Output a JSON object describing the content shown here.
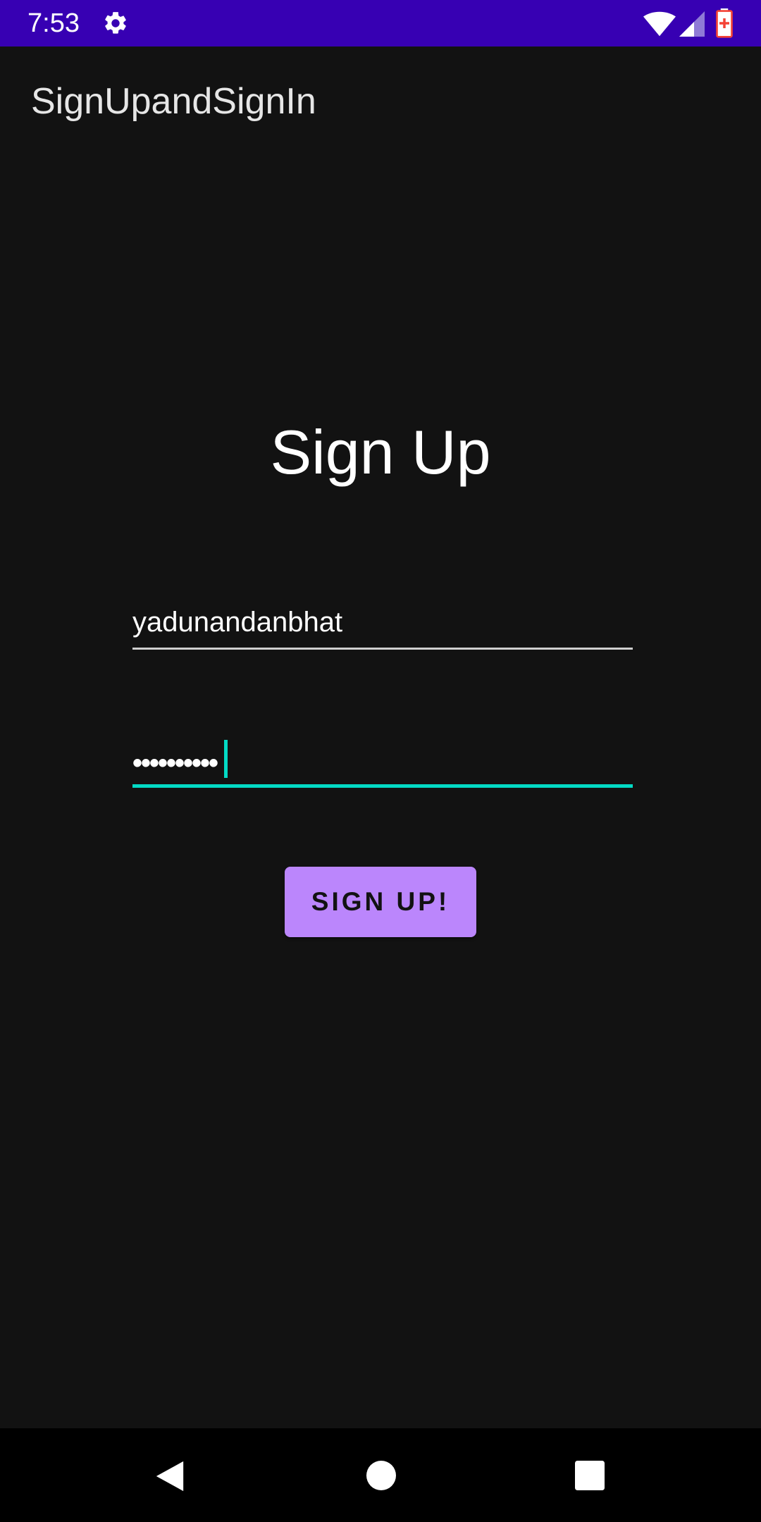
{
  "status_bar": {
    "time": "7:53",
    "background_color": "#3700b3",
    "icons": [
      "gear-icon",
      "wifi-icon",
      "cell-signal-icon",
      "battery-icon"
    ]
  },
  "app_bar": {
    "title": "SignUpandSignIn"
  },
  "form": {
    "heading": "Sign Up",
    "username_value": "yadunandanbhat",
    "password_masked": "••••••••••",
    "submit_label": "SIGN UP!"
  },
  "colors": {
    "background": "#121212",
    "accent": "#03dac5",
    "primary": "#bb86fc"
  },
  "nav_bar": {
    "icons": [
      "back-icon",
      "home-icon",
      "recents-icon"
    ]
  }
}
